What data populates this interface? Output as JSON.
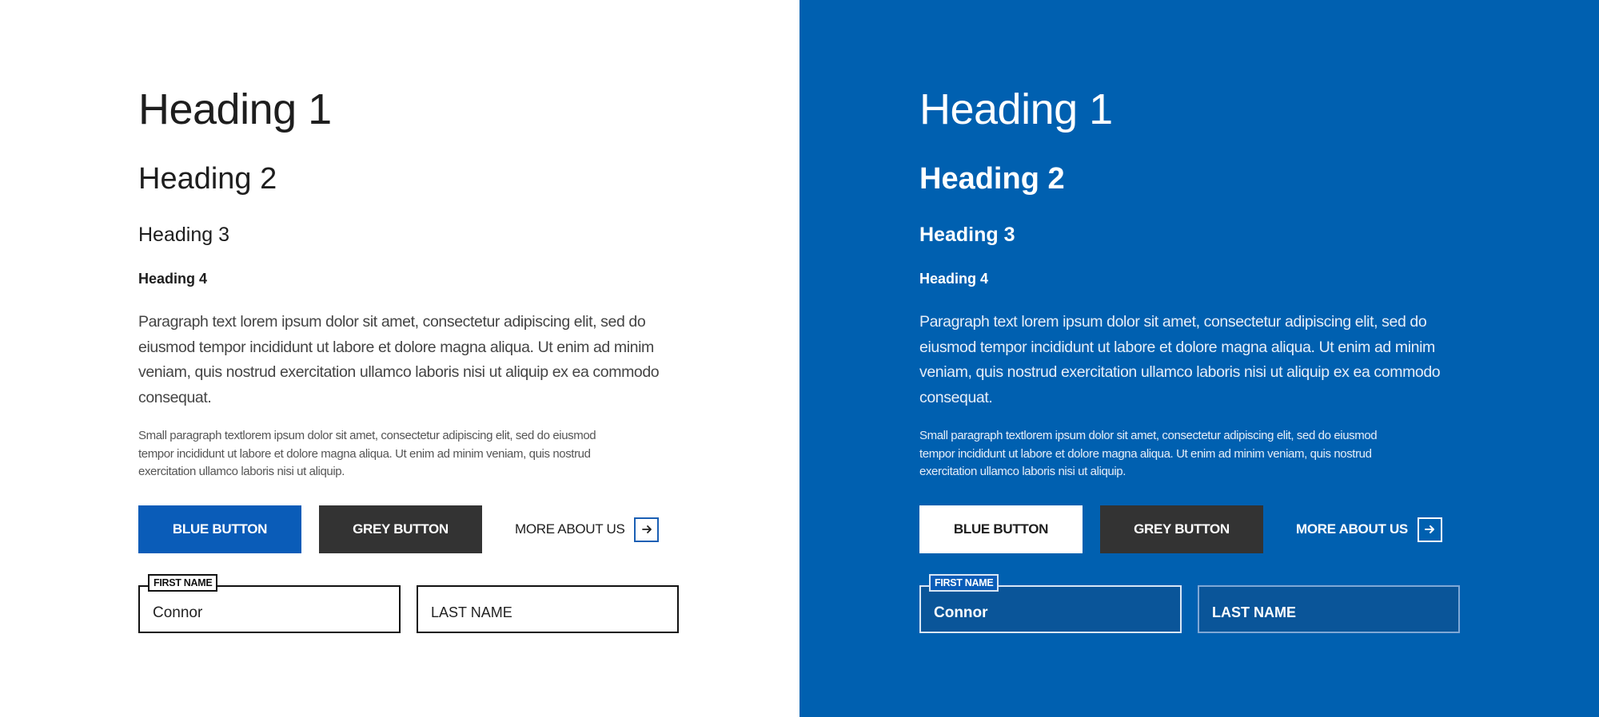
{
  "colors": {
    "brand_blue": "#0060b0",
    "button_blue": "#0a5cb8",
    "button_grey": "#333333",
    "text_dark": "#1e1e1e"
  },
  "panels": [
    {
      "theme": "light",
      "headings": {
        "h1": "Heading 1",
        "h2": "Heading 2",
        "h3": "Heading 3",
        "h4": "Heading 4"
      },
      "paragraph": "Paragraph text lorem ipsum dolor sit amet, consectetur adipiscing elit, sed do eiusmod tempor incididunt ut labore et dolore magna aliqua. Ut enim ad minim veniam, quis nostrud exercitation ullamco laboris nisi ut aliquip ex ea commodo consequat.",
      "small_paragraph": "Small paragraph textlorem ipsum dolor sit amet, consectetur adipiscing elit, sed do eiusmod tempor incididunt ut labore et dolore magna aliqua. Ut enim ad minim veniam, quis nostrud exercitation ullamco laboris nisi ut aliquip.",
      "buttons": {
        "blue": "BLUE BUTTON",
        "grey": "GREY BUTTON",
        "more_link": "MORE ABOUT US",
        "more_icon": "arrow-right-icon"
      },
      "form": {
        "first_name_label": "FIRST NAME",
        "first_name_value": "Connor",
        "last_name_placeholder": "LAST NAME",
        "last_name_value": ""
      }
    },
    {
      "theme": "dark",
      "headings": {
        "h1": "Heading 1",
        "h2": "Heading 2",
        "h3": "Heading 3",
        "h4": "Heading 4"
      },
      "paragraph": "Paragraph text lorem ipsum dolor sit amet, consectetur adipiscing elit, sed do eiusmod tempor incididunt ut labore et dolore magna aliqua. Ut enim ad minim veniam, quis nostrud exercitation ullamco laboris nisi ut aliquip ex ea commodo consequat.",
      "small_paragraph": "Small paragraph textlorem ipsum dolor sit amet, consectetur adipiscing elit, sed do eiusmod tempor incididunt ut labore et dolore magna aliqua. Ut enim ad minim veniam, quis nostrud exercitation ullamco laboris nisi ut aliquip.",
      "buttons": {
        "blue": "BLUE BUTTON",
        "grey": "GREY BUTTON",
        "more_link": "MORE ABOUT US",
        "more_icon": "arrow-right-icon"
      },
      "form": {
        "first_name_label": "FIRST NAME",
        "first_name_value": "Connor",
        "last_name_placeholder": "LAST NAME",
        "last_name_value": ""
      }
    }
  ]
}
